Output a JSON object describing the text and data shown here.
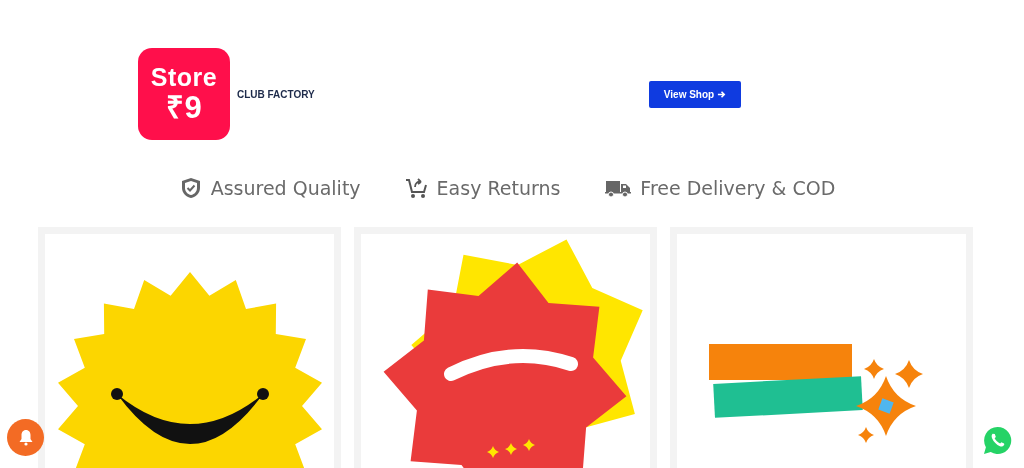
{
  "store": {
    "logo_line_1": "Store",
    "logo_line_2": "₹9",
    "name": "CLUB FACTORY",
    "button": "View Shop"
  },
  "features": [
    {
      "label": "Assured Quality"
    },
    {
      "label": "Easy Returns"
    },
    {
      "label": "Free Delivery & COD"
    }
  ]
}
